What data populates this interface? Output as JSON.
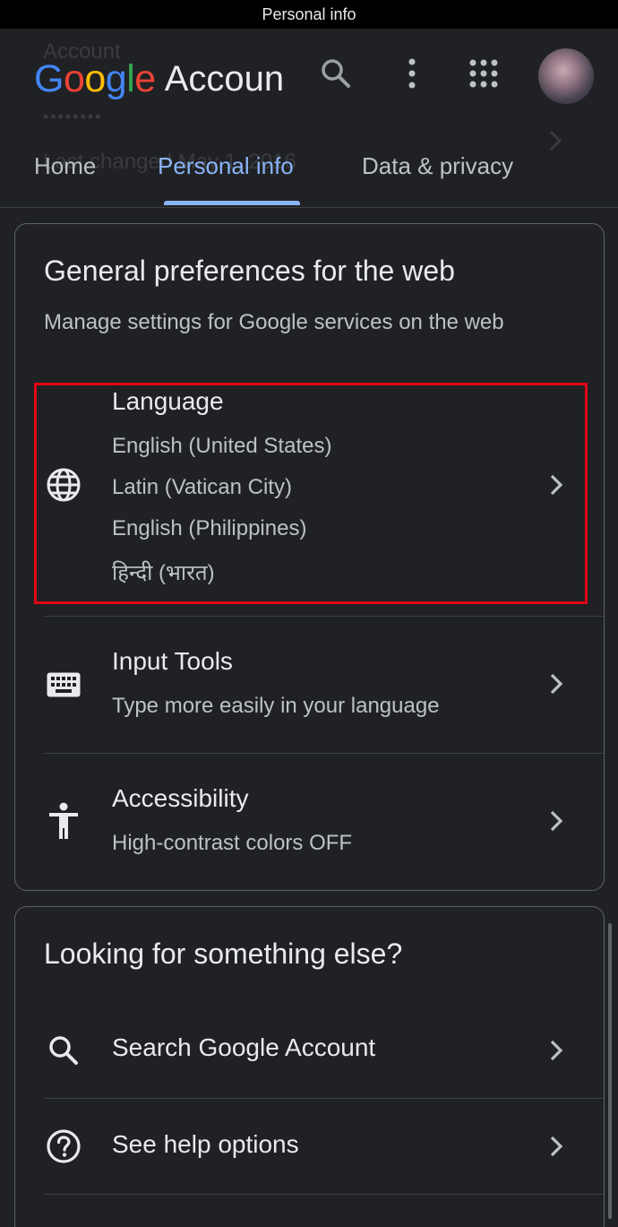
{
  "status_bar": {
    "title": "Personal info"
  },
  "header": {
    "brand": {
      "google_letters": [
        "G",
        "o",
        "o",
        "g",
        "l",
        "e"
      ],
      "product": "Accoun"
    },
    "ghost": {
      "line1": "Account",
      "line2": "••••••••",
      "line3": "Last changed May 1, 2016"
    },
    "tabs": [
      {
        "label": "Home"
      },
      {
        "label": "Personal info",
        "selected": true
      },
      {
        "label": "Data & privacy"
      }
    ],
    "icons": [
      "search-icon",
      "more-vert-icon",
      "apps-icon",
      "avatar"
    ]
  },
  "general_preferences": {
    "title": "General preferences for the web",
    "subtitle": "Manage settings for Google services on the web",
    "items": [
      {
        "title": "Language",
        "icon": "globe-icon",
        "lines": [
          "English (United States)",
          "Latin (Vatican City)",
          "English (Philippines)",
          "हिन्दी (भारत)"
        ],
        "highlighted": true
      },
      {
        "title": "Input Tools",
        "icon": "keyboard-icon",
        "lines": [
          "Type more easily in your language"
        ]
      },
      {
        "title": "Accessibility",
        "icon": "accessibility-icon",
        "lines": [
          "High-contrast colors OFF"
        ]
      }
    ]
  },
  "looking_for": {
    "title": "Looking for something else?",
    "items": [
      {
        "title": "Search Google Account",
        "icon": "search-icon"
      },
      {
        "title": "See help options",
        "icon": "help-icon"
      }
    ]
  },
  "colors": {
    "background": "#202124",
    "accent_blue": "#8ab4f8",
    "highlight_red": "#e30613",
    "google_blue": "#4285F4",
    "google_red": "#EA4335",
    "google_yellow": "#FBBC05",
    "google_green": "#34A853"
  }
}
